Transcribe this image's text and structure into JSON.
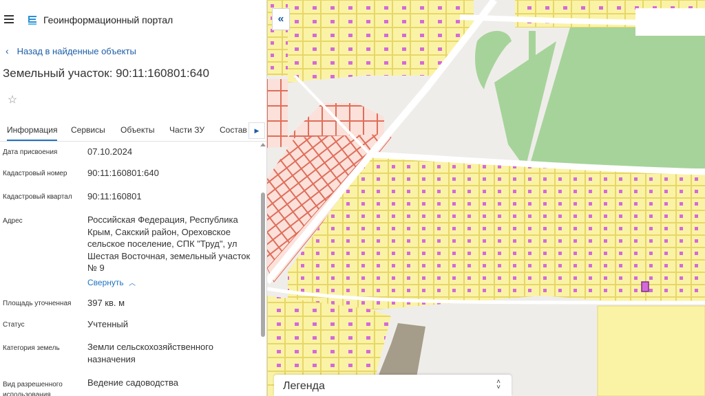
{
  "header": {
    "app_title": "Геоинформационный портал"
  },
  "nav": {
    "back_label": "Назад в найденные объекты"
  },
  "object": {
    "title": "Земельный участок: 90:11:160801:640"
  },
  "tabs": [
    {
      "label": "Информация",
      "active": true
    },
    {
      "label": "Сервисы",
      "active": false
    },
    {
      "label": "Объекты",
      "active": false
    },
    {
      "label": "Части ЗУ",
      "active": false
    },
    {
      "label": "Состав",
      "active": false
    }
  ],
  "properties": [
    {
      "label": "Дата присвоения",
      "value": "07.10.2024"
    },
    {
      "label": "Кадастровый номер",
      "value": "90:11:160801:640"
    },
    {
      "label": "Кадастровый квартал",
      "value": "90:11:160801"
    },
    {
      "label": "Адрес",
      "value": "Российская Федерация, Республика Крым, Сакский район, Ореховское сельское поселение, СПК \"Труд\", ул Шестая Восточная, земельный участок № 9"
    },
    {
      "label": "Площадь уточненная",
      "value": "397 кв. м"
    },
    {
      "label": "Статус",
      "value": "Учтенный"
    },
    {
      "label": "Категория земель",
      "value": "Земли сельскохозяйственного назначения"
    },
    {
      "label": "Вид разрешенного использования",
      "value": "Ведение садоводства"
    }
  ],
  "address_collapse_label": "Свернуть",
  "map": {
    "legend_label": "Легенда",
    "colors": {
      "background": "#efedea",
      "parcel_fill": "#faf3a6",
      "parcel_stroke": "#e3cf57",
      "building": "#d46ad8",
      "red_zone_fill": "#fbe1da",
      "red_zone_stroke": "#d9503a",
      "green": "#a6d39a",
      "brown": "#a59c8a",
      "road": "#ffffff"
    }
  }
}
